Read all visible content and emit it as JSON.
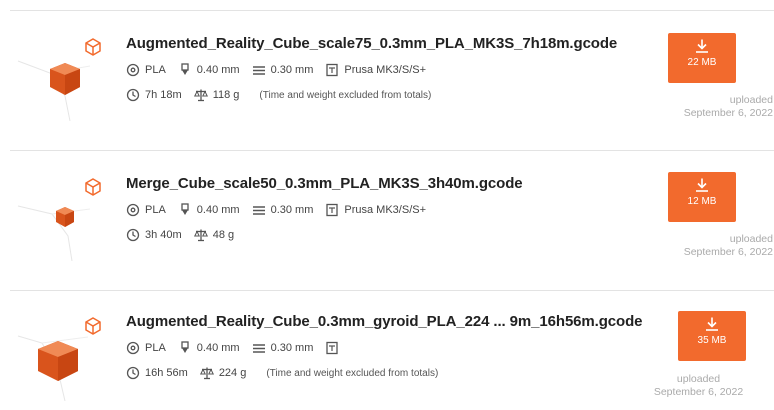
{
  "colors": {
    "accent": "#f26a2d",
    "muted": "#aaaaaa",
    "text": "#222222"
  },
  "files": [
    {
      "name": "Augmented_Reality_Cube_scale75_0.3mm_PLA_MK3S_7h18m.gcode",
      "material": "PLA",
      "nozzle": "0.40 mm",
      "layer": "0.30 mm",
      "printer": "Prusa MK3/S/S+",
      "time": "7h 18m",
      "weight": "118 g",
      "note": "(Time and weight excluded from totals)",
      "size": "22 MB",
      "uploaded_label": "uploaded",
      "uploaded_date": "September 6, 2022"
    },
    {
      "name": "Merge_Cube_scale50_0.3mm_PLA_MK3S_3h40m.gcode",
      "material": "PLA",
      "nozzle": "0.40 mm",
      "layer": "0.30 mm",
      "printer": "Prusa MK3/S/S+",
      "time": "3h 40m",
      "weight": "48 g",
      "note": "",
      "size": "12 MB",
      "uploaded_label": "uploaded",
      "uploaded_date": "September 6, 2022"
    },
    {
      "name": "Augmented_Reality_Cube_0.3mm_gyroid_PLA_224 ... 9m_16h56m.gcode",
      "material": "PLA",
      "nozzle": "0.40 mm",
      "layer": "0.30 mm",
      "printer": "",
      "time": "16h 56m",
      "weight": "224 g",
      "note": "(Time and weight excluded from totals)",
      "size": "35 MB",
      "uploaded_label": "uploaded",
      "uploaded_date": "September 6, 2022"
    }
  ]
}
